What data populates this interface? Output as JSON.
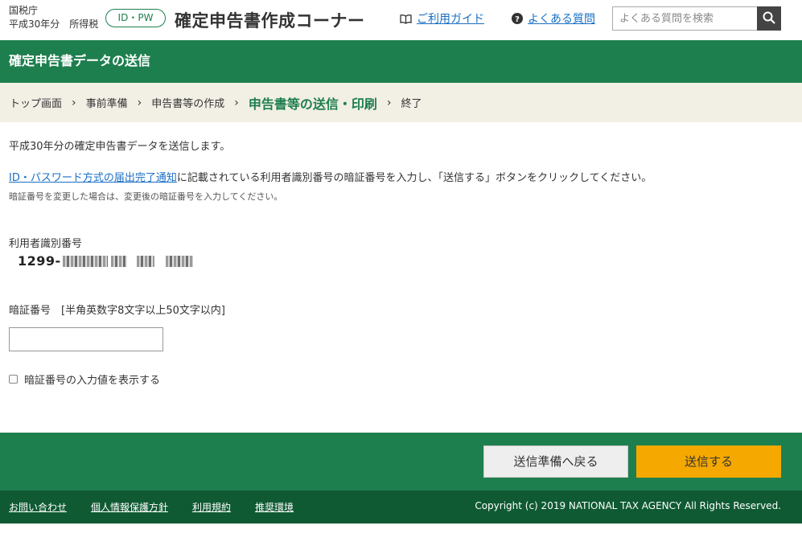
{
  "header": {
    "agency": "国税庁",
    "year_tax": "平成30年分　所得税",
    "badge": "ID・PW",
    "app_title": "確定申告書作成コーナー",
    "guide_link": "ご利用ガイド",
    "faq_link": "よくある質問",
    "search_placeholder": "よくある質問を検索"
  },
  "titlebar": {
    "title": "確定申告書データの送信"
  },
  "breadcrumb": {
    "items": [
      "トップ画面",
      "事前準備",
      "申告書等の作成",
      "申告書等の送信・印刷",
      "終了"
    ],
    "separator": "›",
    "current_index": 3
  },
  "main": {
    "intro": "平成30年分の確定申告書データを送信します。",
    "notice_link": "ID・パスワード方式の届出完了通知",
    "instruction": "に記載されている利用者識別番号の暗証番号を入力し、「送信する」ボタンをクリックしてください。",
    "note": "暗証番号を変更した場合は、変更後の暗証番号を入力してください。",
    "id_label": "利用者識別番号",
    "id_value_prefix": "1299-",
    "pin_label": "暗証番号　[半角英数字8文字以上50文字以内]",
    "pin_value": "",
    "show_pin_label": "暗証番号の入力値を表示する"
  },
  "actions": {
    "back_label": "送信準備へ戻る",
    "send_label": "送信する"
  },
  "footer": {
    "links": [
      "お問い合わせ",
      "個人情報保護方針",
      "利用規約",
      "推奨環境"
    ],
    "copyright": "Copyright (c) 2019 NATIONAL TAX AGENCY All Rights Reserved."
  },
  "colors": {
    "brand_green": "#1e7f4e",
    "footer_green": "#0f5a33",
    "send_button": "#f5a800",
    "crumb_bg": "#f2efe5",
    "link": "#1a6fc4"
  },
  "icons": [
    "book-icon",
    "question-icon",
    "search-icon"
  ]
}
